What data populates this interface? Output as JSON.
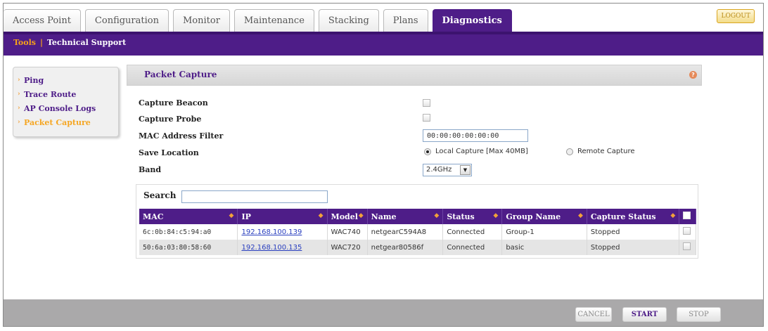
{
  "tabs": [
    {
      "label": "Access Point",
      "active": false
    },
    {
      "label": "Configuration",
      "active": false
    },
    {
      "label": "Monitor",
      "active": false
    },
    {
      "label": "Maintenance",
      "active": false
    },
    {
      "label": "Stacking",
      "active": false
    },
    {
      "label": "Plans",
      "active": false
    },
    {
      "label": "Diagnostics",
      "active": true
    }
  ],
  "logout_label": "LOGOUT",
  "subnav": {
    "tools": "Tools",
    "separator": "|",
    "support": "Technical Support"
  },
  "sidebar": {
    "items": [
      {
        "label": "Ping",
        "active": false
      },
      {
        "label": "Trace Route",
        "active": false
      },
      {
        "label": "AP Console Logs",
        "active": false
      },
      {
        "label": "Packet Capture",
        "active": true
      }
    ]
  },
  "panel": {
    "title": "Packet Capture",
    "help_icon": "?",
    "fields": {
      "capture_beacon": {
        "label": "Capture Beacon",
        "checked": false
      },
      "capture_probe": {
        "label": "Capture Probe",
        "checked": false
      },
      "mac_filter": {
        "label": "MAC Address Filter",
        "value": "00:00:00:00:00:00"
      },
      "save_location": {
        "label": "Save Location",
        "options": [
          "Local Capture [Max 40MB]",
          "Remote Capture"
        ],
        "selected": "Local Capture [Max 40MB]"
      },
      "band": {
        "label": "Band",
        "value": "2.4GHz"
      }
    }
  },
  "table": {
    "search_label": "Search",
    "search_value": "",
    "headers": [
      "MAC",
      "IP",
      "Model",
      "Name",
      "Status",
      "Group Name",
      "Capture Status"
    ],
    "rows": [
      {
        "mac": "6c:0b:84:c5:94:a0",
        "ip": "192.168.100.139",
        "model": "WAC740",
        "name": "netgearC594A8",
        "status": "Connected",
        "group": "Group-1",
        "capture": "Stopped"
      },
      {
        "mac": "50:6a:03:80:58:60",
        "ip": "192.168.100.135",
        "model": "WAC720",
        "name": "netgear80586f",
        "status": "Connected",
        "group": "basic",
        "capture": "Stopped"
      }
    ]
  },
  "buttons": {
    "cancel": "CANCEL",
    "start": "START",
    "stop": "STOP"
  },
  "colors": {
    "brand_purple": "#4e1d88",
    "accent_orange": "#f5a623",
    "bottom_bar": "#aaa9aa"
  }
}
